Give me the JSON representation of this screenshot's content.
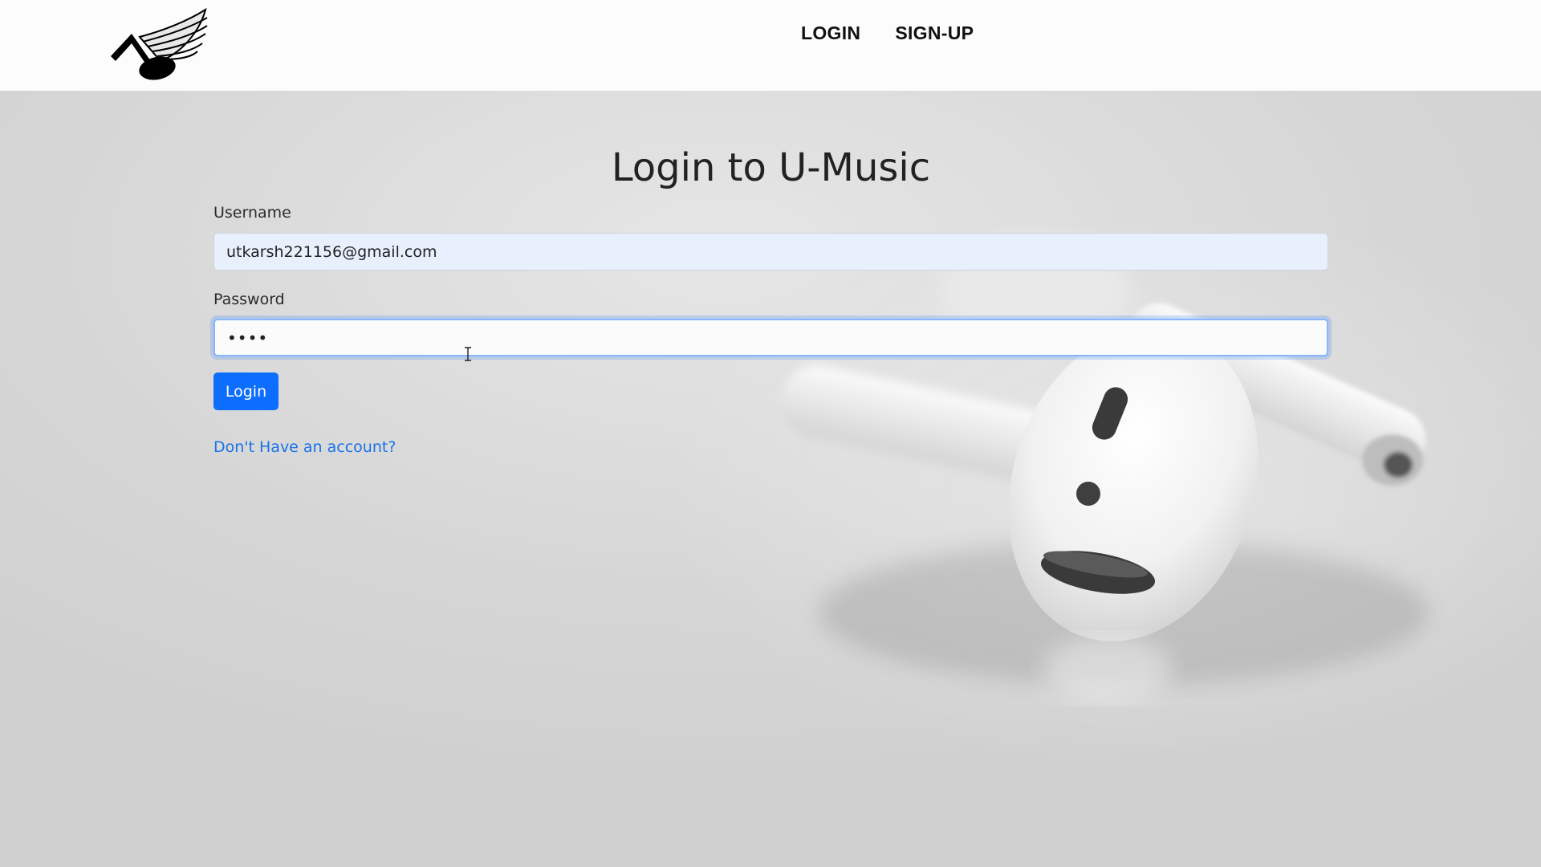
{
  "app": {
    "title": "Login to U-Music"
  },
  "nav": {
    "logo_icon": "music-note-with-wing-logo",
    "links": [
      {
        "label": "LOGIN"
      },
      {
        "label": "SIGN-UP"
      }
    ]
  },
  "form": {
    "title": "Login to U-Music",
    "username": {
      "label": "Username",
      "value": "utkarsh221156@gmail.com"
    },
    "password": {
      "label": "Password",
      "masked_value": "••••"
    },
    "submit_label": "Login",
    "signup_prompt": "Don't Have an account?"
  },
  "colors": {
    "accent": "#0d6efd",
    "link": "#1a73e8",
    "navbar_bg": "#fcfcfc",
    "username_fill": "#e8f0fe",
    "focus_border": "#86b7fe"
  }
}
